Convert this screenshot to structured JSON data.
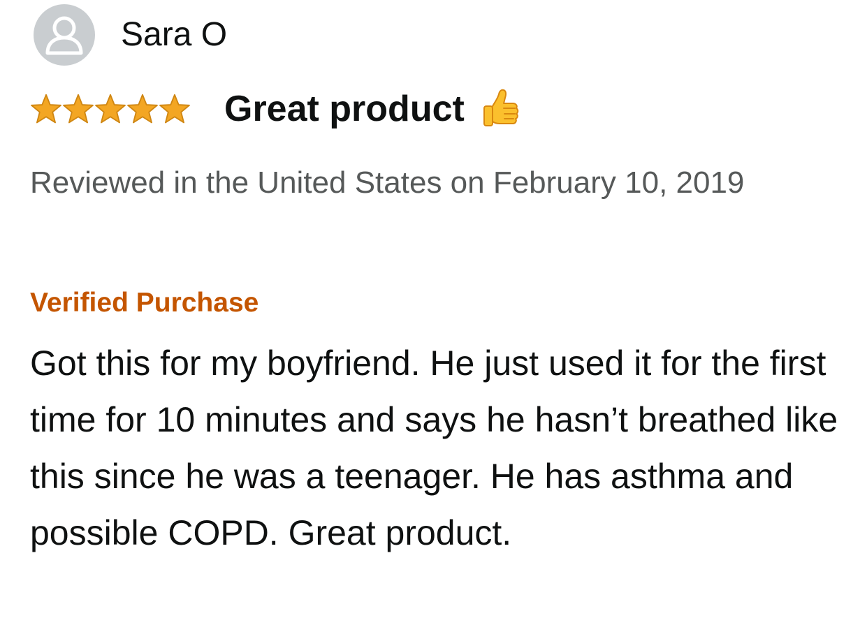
{
  "reviewer": {
    "name": "Sara O",
    "avatar_icon": "default-user-avatar-icon"
  },
  "rating": {
    "stars": 5,
    "max_stars": 5,
    "star_color": "#f0a81c",
    "star_icon": "star-icon"
  },
  "review": {
    "headline": "Great product",
    "headline_emoji_icon": "thumbs-up-icon",
    "date_text": "Reviewed in the United States on February 10, 2019",
    "verified_label": "Verified Purchase",
    "verified_color": "#c45500",
    "body": "Got this for my boyfriend. He just used it for the first time for 10 minutes and says he hasn’t breathed like this since he was a teenager. He has asthma and possible COPD. Great product."
  }
}
